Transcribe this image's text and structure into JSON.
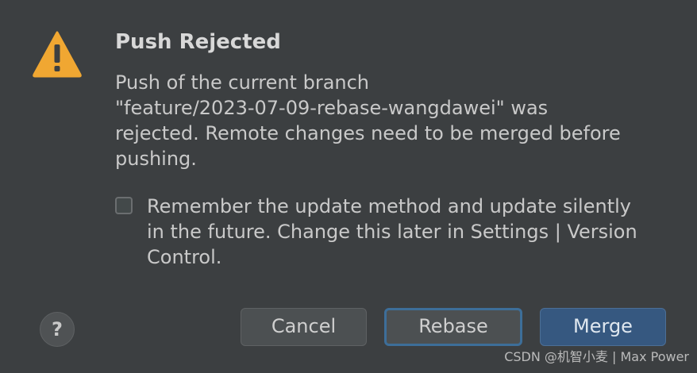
{
  "dialog": {
    "title": "Push Rejected",
    "message_lines": [
      "Push of the current branch",
      "\"feature/2023-07-09-rebase-wangdawei\" was",
      "rejected. Remote changes need to be merged before",
      "pushing."
    ],
    "remember_lines": [
      "Remember the update method and update silently",
      "in the future. Change this later in Settings | Version",
      "Control."
    ],
    "remember_checked": false
  },
  "buttons": {
    "help_label": "?",
    "cancel_label": "Cancel",
    "rebase_label": "Rebase",
    "merge_label": "Merge"
  },
  "icons": {
    "warning": "warning-triangle-icon",
    "help": "question-mark-icon"
  },
  "colors": {
    "background": "#3c3f41",
    "warning": "#f0a732",
    "primary_button": "#365880",
    "focus_ring": "#3d6e99"
  },
  "watermark": "CSDN @机智小麦 | Max Power"
}
